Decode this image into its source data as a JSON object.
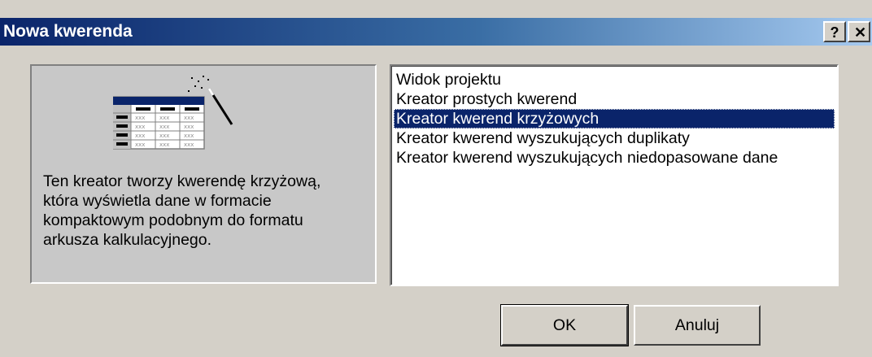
{
  "dialog": {
    "title": "Nowa kwerenda",
    "help_label": "?",
    "close_label": "✕"
  },
  "info": {
    "description": "Ten kreator tworzy kwerendę krzyżową,\nktóra wyświetla dane w formacie\nkompaktowym podobnym do formatu\narkusza kalkulacyjnego.",
    "illustration_icon": "crosstab-wizard-icon",
    "illustration_cells": "xxx"
  },
  "list": {
    "items": [
      {
        "label": "Widok projektu",
        "selected": false
      },
      {
        "label": "Kreator prostych kwerend",
        "selected": false
      },
      {
        "label": "Kreator kwerend krzyżowych",
        "selected": true
      },
      {
        "label": "Kreator kwerend wyszukujących duplikaty",
        "selected": false
      },
      {
        "label": "Kreator kwerend wyszukujących niedopasowane dane",
        "selected": false
      }
    ]
  },
  "buttons": {
    "ok_label": "OK",
    "cancel_label": "Anuluj"
  },
  "colors": {
    "title_bar_start": "#0a246a",
    "title_bar_end": "#a6caf0",
    "selection": "#0a246a",
    "dialog_face": "#d4d0c8"
  }
}
